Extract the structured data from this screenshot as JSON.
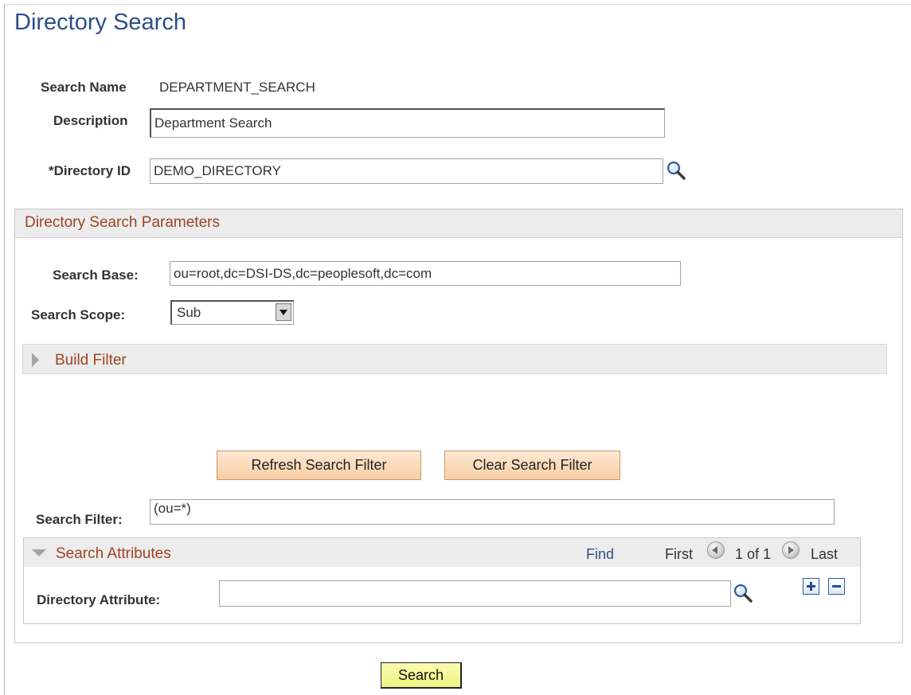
{
  "page": {
    "title": "Directory Search"
  },
  "header_fields": {
    "search_name_label": "Search Name",
    "search_name_value": "DEPARTMENT_SEARCH",
    "description_label": "Description",
    "description_value": "Department Search",
    "directory_id_label": "*Directory ID",
    "directory_id_value": "DEMO_DIRECTORY"
  },
  "params": {
    "header": "Directory Search Parameters",
    "search_base_label": "Search Base:",
    "search_base_value": "ou=root,dc=DSI-DS,dc=peoplesoft,dc=com",
    "search_scope_label": "Search Scope:",
    "search_scope_value": "Sub",
    "build_filter_label": "Build Filter",
    "refresh_button": "Refresh Search Filter",
    "clear_button": "Clear Search Filter",
    "search_filter_label": "Search Filter:",
    "search_filter_value": "(ou=*)"
  },
  "attributes": {
    "header": "Search Attributes",
    "find_link": "Find",
    "first_label": "First",
    "page_info": "1 of 1",
    "last_label": "Last",
    "directory_attribute_label": "Directory Attribute:",
    "directory_attribute_value": ""
  },
  "footer": {
    "search_button": "Search"
  },
  "icons": {
    "lookup": "magnifying-glass-icon",
    "add_row": "plus-icon",
    "delete_row": "minus-icon",
    "prev": "previous-circle-icon",
    "next": "next-circle-icon"
  },
  "colors": {
    "title": "#2c4f86",
    "section_header_text": "#9f4323",
    "link": "#2c4f86",
    "orange_button": "#f8cfa5",
    "yellow_button": "#eef280"
  }
}
